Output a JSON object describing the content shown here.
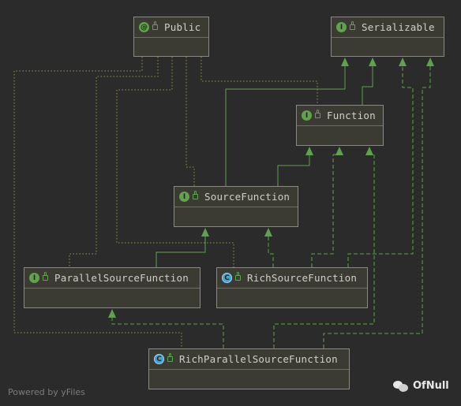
{
  "diagram": {
    "nodes": [
      {
        "id": "public",
        "kind": "annotation",
        "glyph": "@",
        "label": "Public"
      },
      {
        "id": "serializable",
        "kind": "interface",
        "glyph": "I",
        "label": "Serializable"
      },
      {
        "id": "function",
        "kind": "interface",
        "glyph": "I",
        "label": "Function"
      },
      {
        "id": "source_function",
        "kind": "interface",
        "glyph": "I",
        "label": "SourceFunction"
      },
      {
        "id": "parallel_source_function",
        "kind": "interface",
        "glyph": "I",
        "label": "ParallelSourceFunction"
      },
      {
        "id": "rich_source_function",
        "kind": "class",
        "glyph": "C",
        "label": "RichSourceFunction"
      },
      {
        "id": "rich_parallel_source_function",
        "kind": "class",
        "glyph": "C",
        "label": "RichParallelSourceFunction"
      }
    ],
    "edges": [
      {
        "from": "function",
        "to": "serializable",
        "type": "extends"
      },
      {
        "from": "source_function",
        "to": "serializable",
        "type": "extends"
      },
      {
        "from": "source_function",
        "to": "function",
        "type": "extends"
      },
      {
        "from": "parallel_source_function",
        "to": "source_function",
        "type": "extends"
      },
      {
        "from": "rich_source_function",
        "to": "source_function",
        "type": "implements"
      },
      {
        "from": "rich_source_function",
        "to": "serializable",
        "type": "implements"
      },
      {
        "from": "rich_source_function",
        "to": "function",
        "type": "implements"
      },
      {
        "from": "rich_parallel_source_function",
        "to": "parallel_source_function",
        "type": "implements"
      },
      {
        "from": "rich_parallel_source_function",
        "to": "function",
        "type": "implements"
      },
      {
        "from": "rich_parallel_source_function",
        "to": "serializable",
        "type": "implements"
      },
      {
        "from": "function",
        "to": "public",
        "type": "annotated"
      },
      {
        "from": "source_function",
        "to": "public",
        "type": "annotated"
      },
      {
        "from": "parallel_source_function",
        "to": "public",
        "type": "annotated"
      },
      {
        "from": "rich_source_function",
        "to": "public",
        "type": "annotated"
      },
      {
        "from": "rich_parallel_source_function",
        "to": "public",
        "type": "annotated"
      }
    ]
  },
  "footer": {
    "text": "Powered by yFiles"
  },
  "watermark": {
    "text": "OfNull",
    "icon": "wechat-icon"
  },
  "colors": {
    "background": "#2b2b2b",
    "node_fill": "#3c3b33",
    "edge_green": "#5fa24d",
    "annotation_edge": "#9a8f52"
  }
}
